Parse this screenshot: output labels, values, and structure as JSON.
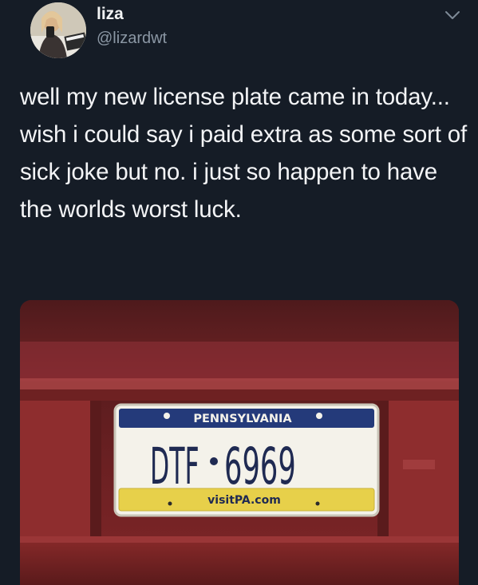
{
  "user": {
    "display_name": "liza",
    "handle": "@lizardwt"
  },
  "tweet": {
    "text": "well my new license plate came in today... wish i could say i paid extra as some sort of sick joke but no. i just so happen to have the worlds worst luck."
  },
  "plate": {
    "state": "PENNSYLVANIA",
    "number_left": "DTF",
    "number_right": "6969",
    "website": "visitPA.com"
  },
  "icons": {
    "menu": "chevron-down-icon",
    "avatar": "profile-photo"
  },
  "colors": {
    "background": "#151c26",
    "handle": "#8b97a4",
    "plate_blue": "#243a7a",
    "plate_yellow": "#e7d04a",
    "car_red": "#8a2a2a"
  }
}
